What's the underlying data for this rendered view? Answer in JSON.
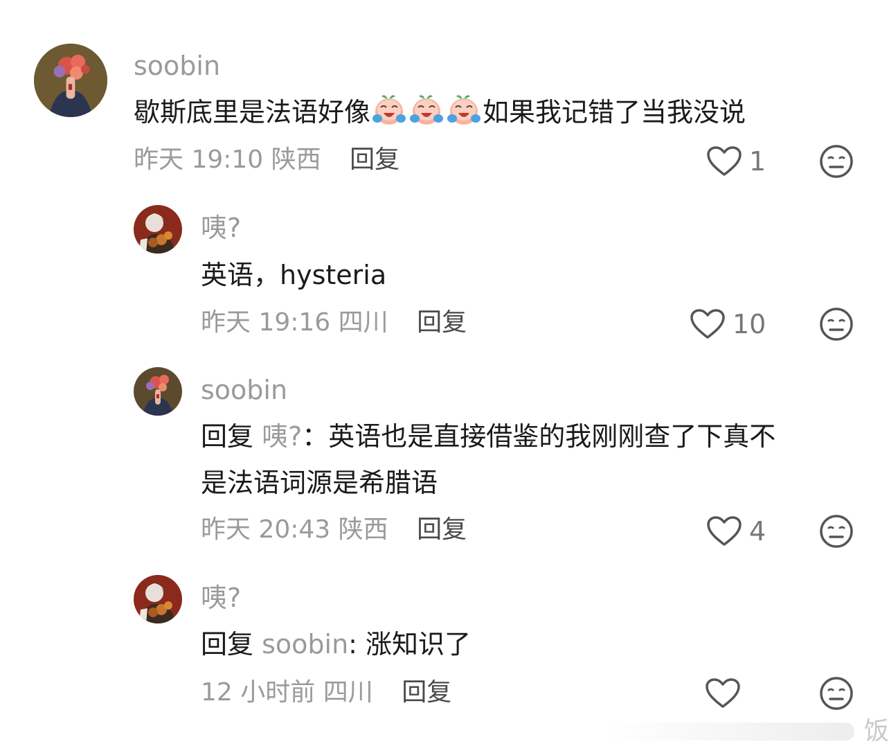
{
  "comments": [
    {
      "username": "soobin",
      "text_before": "歇斯底里是法语好像",
      "emoji": "crying-laughing-peach-emoji",
      "emoji_count": 3,
      "text_after": "如果我记错了当我没说",
      "time": "昨天 19:10",
      "location": "陕西",
      "reply_label": "回复",
      "likes": "1"
    },
    {
      "username": "咦?",
      "text": "英语，hysteria",
      "time": "昨天 19:16",
      "location": "四川",
      "reply_label": "回复",
      "likes": "10"
    },
    {
      "username": "soobin",
      "reply_prefix": "回复",
      "mention": "咦?",
      "text_line1": "：英语也是直接借鉴的我刚刚查了下真不",
      "text_line2": "是法语词源是希腊语",
      "time": "昨天 20:43",
      "location": "陕西",
      "reply_label": "回复",
      "likes": "4"
    },
    {
      "username": "咦?",
      "reply_prefix": "回复",
      "mention": "soobin",
      "text": ": 涨知识了",
      "time": "12 小时前",
      "location": "四川",
      "reply_label": "回复",
      "likes": ""
    }
  ],
  "watermark": {
    "text": "饭"
  },
  "colors": {
    "muted": "#9a9a9a",
    "text": "#1a1a1a",
    "icon": "#555555"
  }
}
